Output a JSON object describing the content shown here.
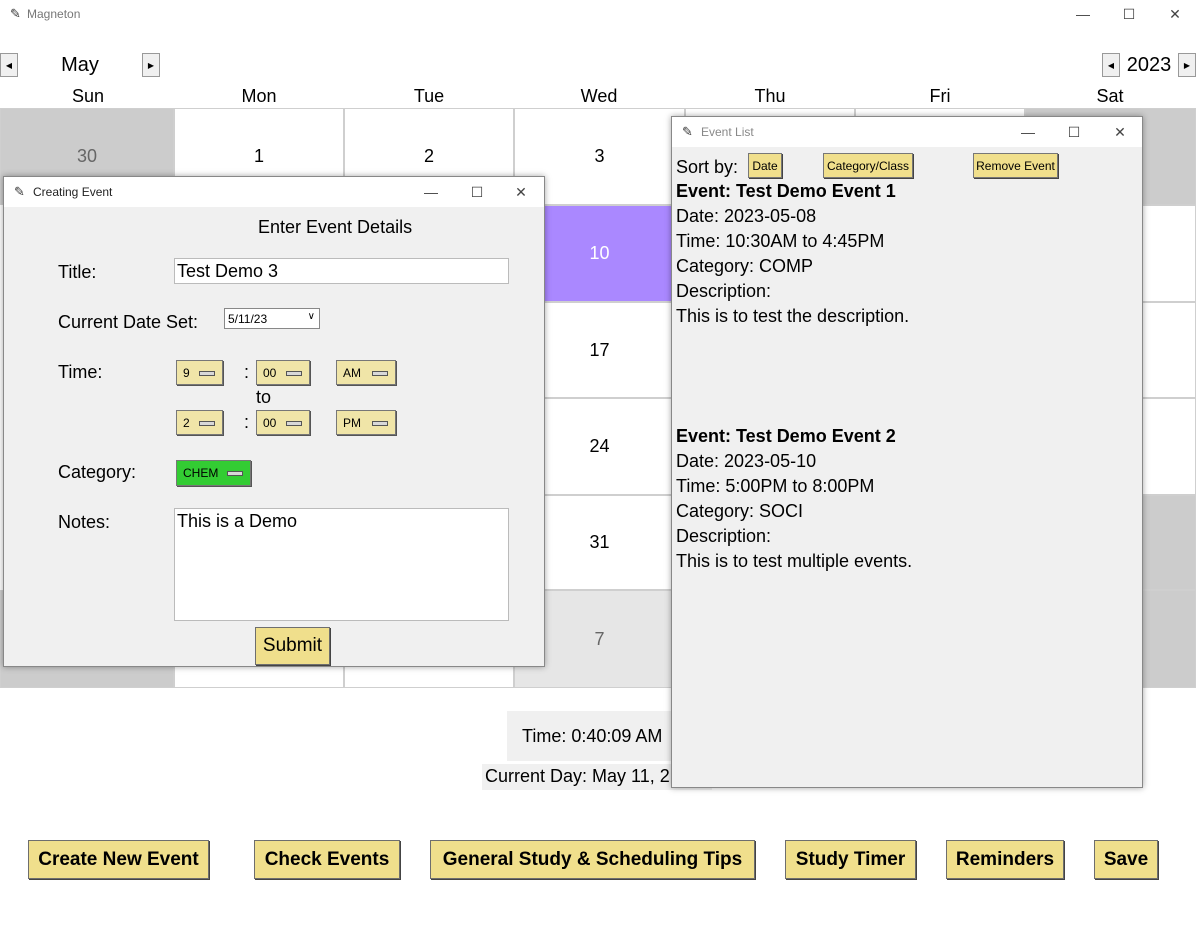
{
  "main_window": {
    "title": "Magneton"
  },
  "nav": {
    "month": "May",
    "year": "2023"
  },
  "day_headers": [
    "Sun",
    "Mon",
    "Tue",
    "Wed",
    "Thu",
    "Fri",
    "Sat"
  ],
  "calendar": {
    "row1": [
      "30",
      "1",
      "2",
      "3"
    ],
    "wed_col": [
      "10",
      "17",
      "24",
      "31",
      "7"
    ]
  },
  "status": {
    "time": "Time: 0:40:09 AM",
    "current_day": "Current Day: May 11, 2"
  },
  "bottom_buttons": {
    "create": "Create New Event",
    "check": "Check Events",
    "tips": "General Study & Scheduling Tips",
    "timer": "Study Timer",
    "reminders": "Reminders",
    "save": "Save"
  },
  "create_window": {
    "title": "Creating Event",
    "heading": "Enter Event Details",
    "title_label": "Title:",
    "title_value": "Test Demo 3",
    "date_label": "Current Date Set:",
    "date_value": "5/11/23",
    "time_label": "Time:",
    "start_hour": "9",
    "start_min": "00",
    "start_ampm": "AM",
    "colon": ":",
    "to": "to",
    "end_hour": "2",
    "end_min": "00",
    "end_ampm": "PM",
    "category_label": "Category:",
    "category_value": "CHEM",
    "category_color": "#33cc33",
    "notes_label": "Notes:",
    "notes_value": "This is a Demo",
    "submit": "Submit"
  },
  "event_list_window": {
    "title": "Event List",
    "sort_label": "Sort by:",
    "sort_date": "Date",
    "sort_category": "Category/Class",
    "remove": "Remove Event",
    "events": [
      {
        "heading": "Event: Test Demo Event 1",
        "date": "Date: 2023-05-08",
        "time": "Time: 10:30AM to 4:45PM",
        "category": "Category: COMP",
        "desc_label": "Description:",
        "desc": "This is to test the description."
      },
      {
        "heading": "Event: Test Demo Event 2",
        "date": "Date: 2023-05-10",
        "time": "Time: 5:00PM to 8:00PM",
        "category": "Category: SOCI",
        "desc_label": "Description:",
        "desc": "This is to test multiple events."
      }
    ]
  },
  "colors": {
    "button_yellow": "#f0df8c",
    "highlight_purple": "#aa88ff",
    "grey_cell": "#cccccc"
  }
}
